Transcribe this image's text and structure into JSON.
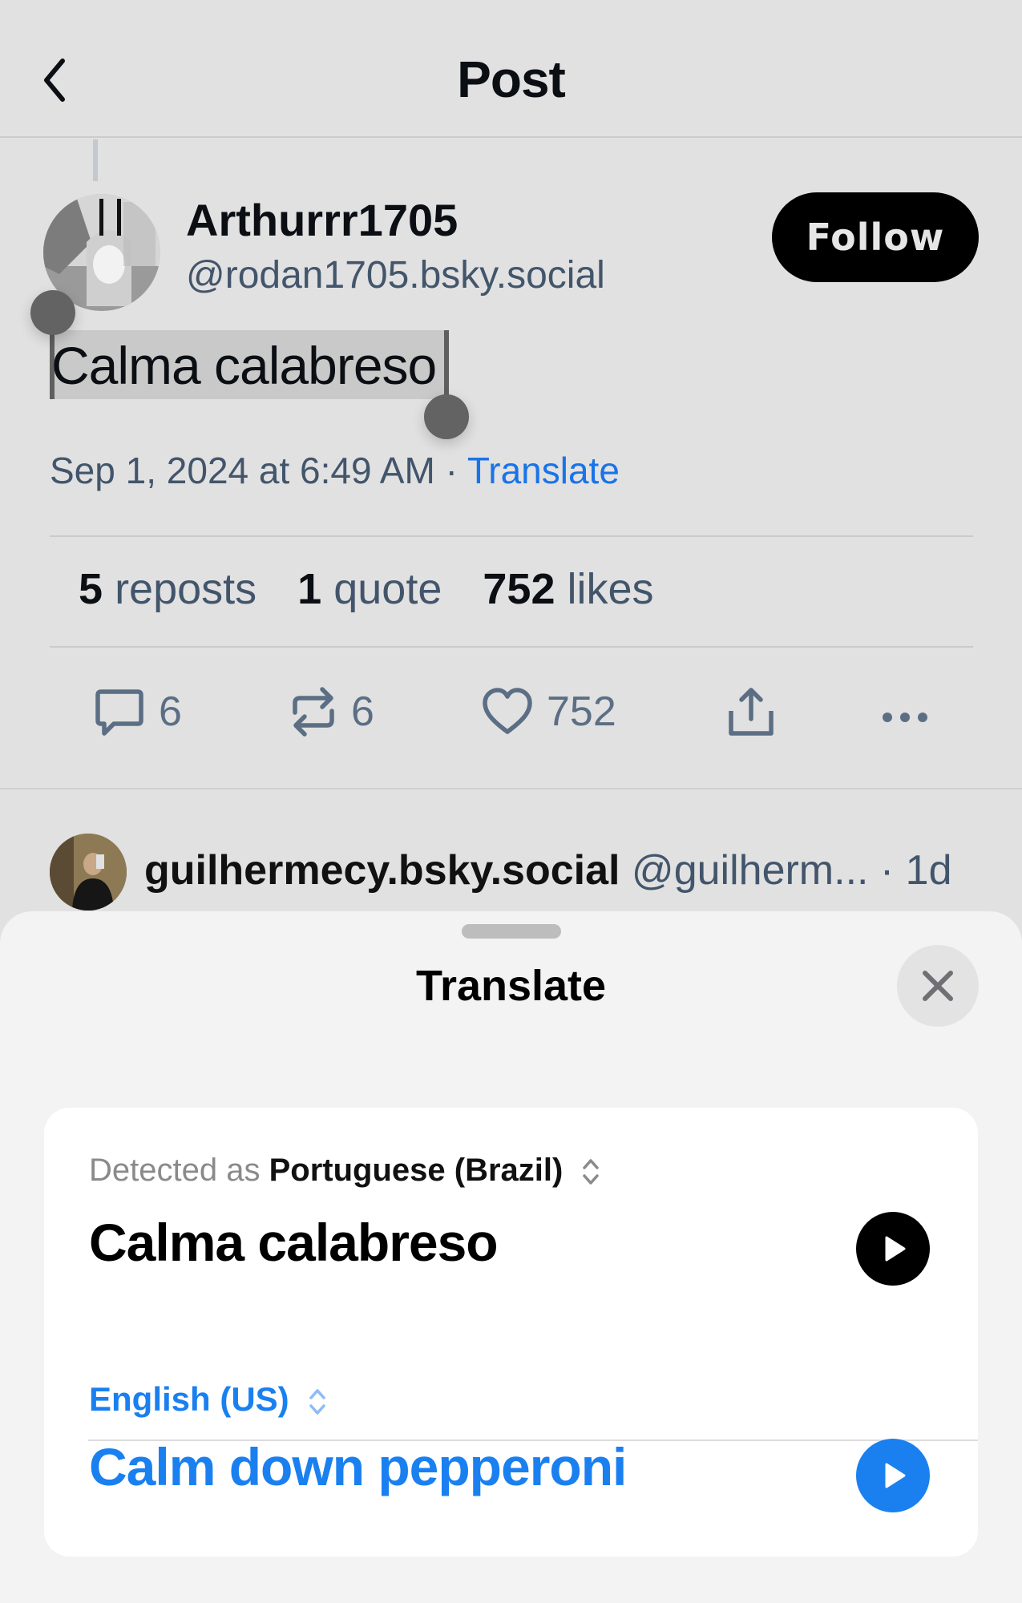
{
  "header": {
    "title": "Post",
    "back_icon": "chevron-left-icon"
  },
  "post": {
    "author": {
      "display_name": "Arthurrr1705",
      "handle": "@rodan1705.bsky.social"
    },
    "follow_label": "Follow",
    "text": "Calma calabreso",
    "timestamp": "Sep 1, 2024 at 6:49 AM",
    "meta_separator": "·",
    "translate_link": "Translate",
    "stats": {
      "reposts_count": "5",
      "reposts_label": "reposts",
      "quotes_count": "1",
      "quotes_label": "quote",
      "likes_count": "752",
      "likes_label": "likes"
    },
    "actions": {
      "reply_count": "6",
      "repost_count": "6",
      "like_count": "752"
    }
  },
  "reply": {
    "display_name": "guilhermecy.bsky.social",
    "handle": "@guilherm...",
    "age": "· 1d"
  },
  "translate_sheet": {
    "title": "Translate",
    "detected_prefix": "Detected as",
    "source_language": "Portuguese (Brazil)",
    "source_text": "Calma calabreso",
    "target_language": "English (US)",
    "target_text": "Calm down pepperoni"
  },
  "colors": {
    "accent_blue": "#1a80f0",
    "link_blue": "#1a73e8",
    "muted_text": "#42556b"
  }
}
